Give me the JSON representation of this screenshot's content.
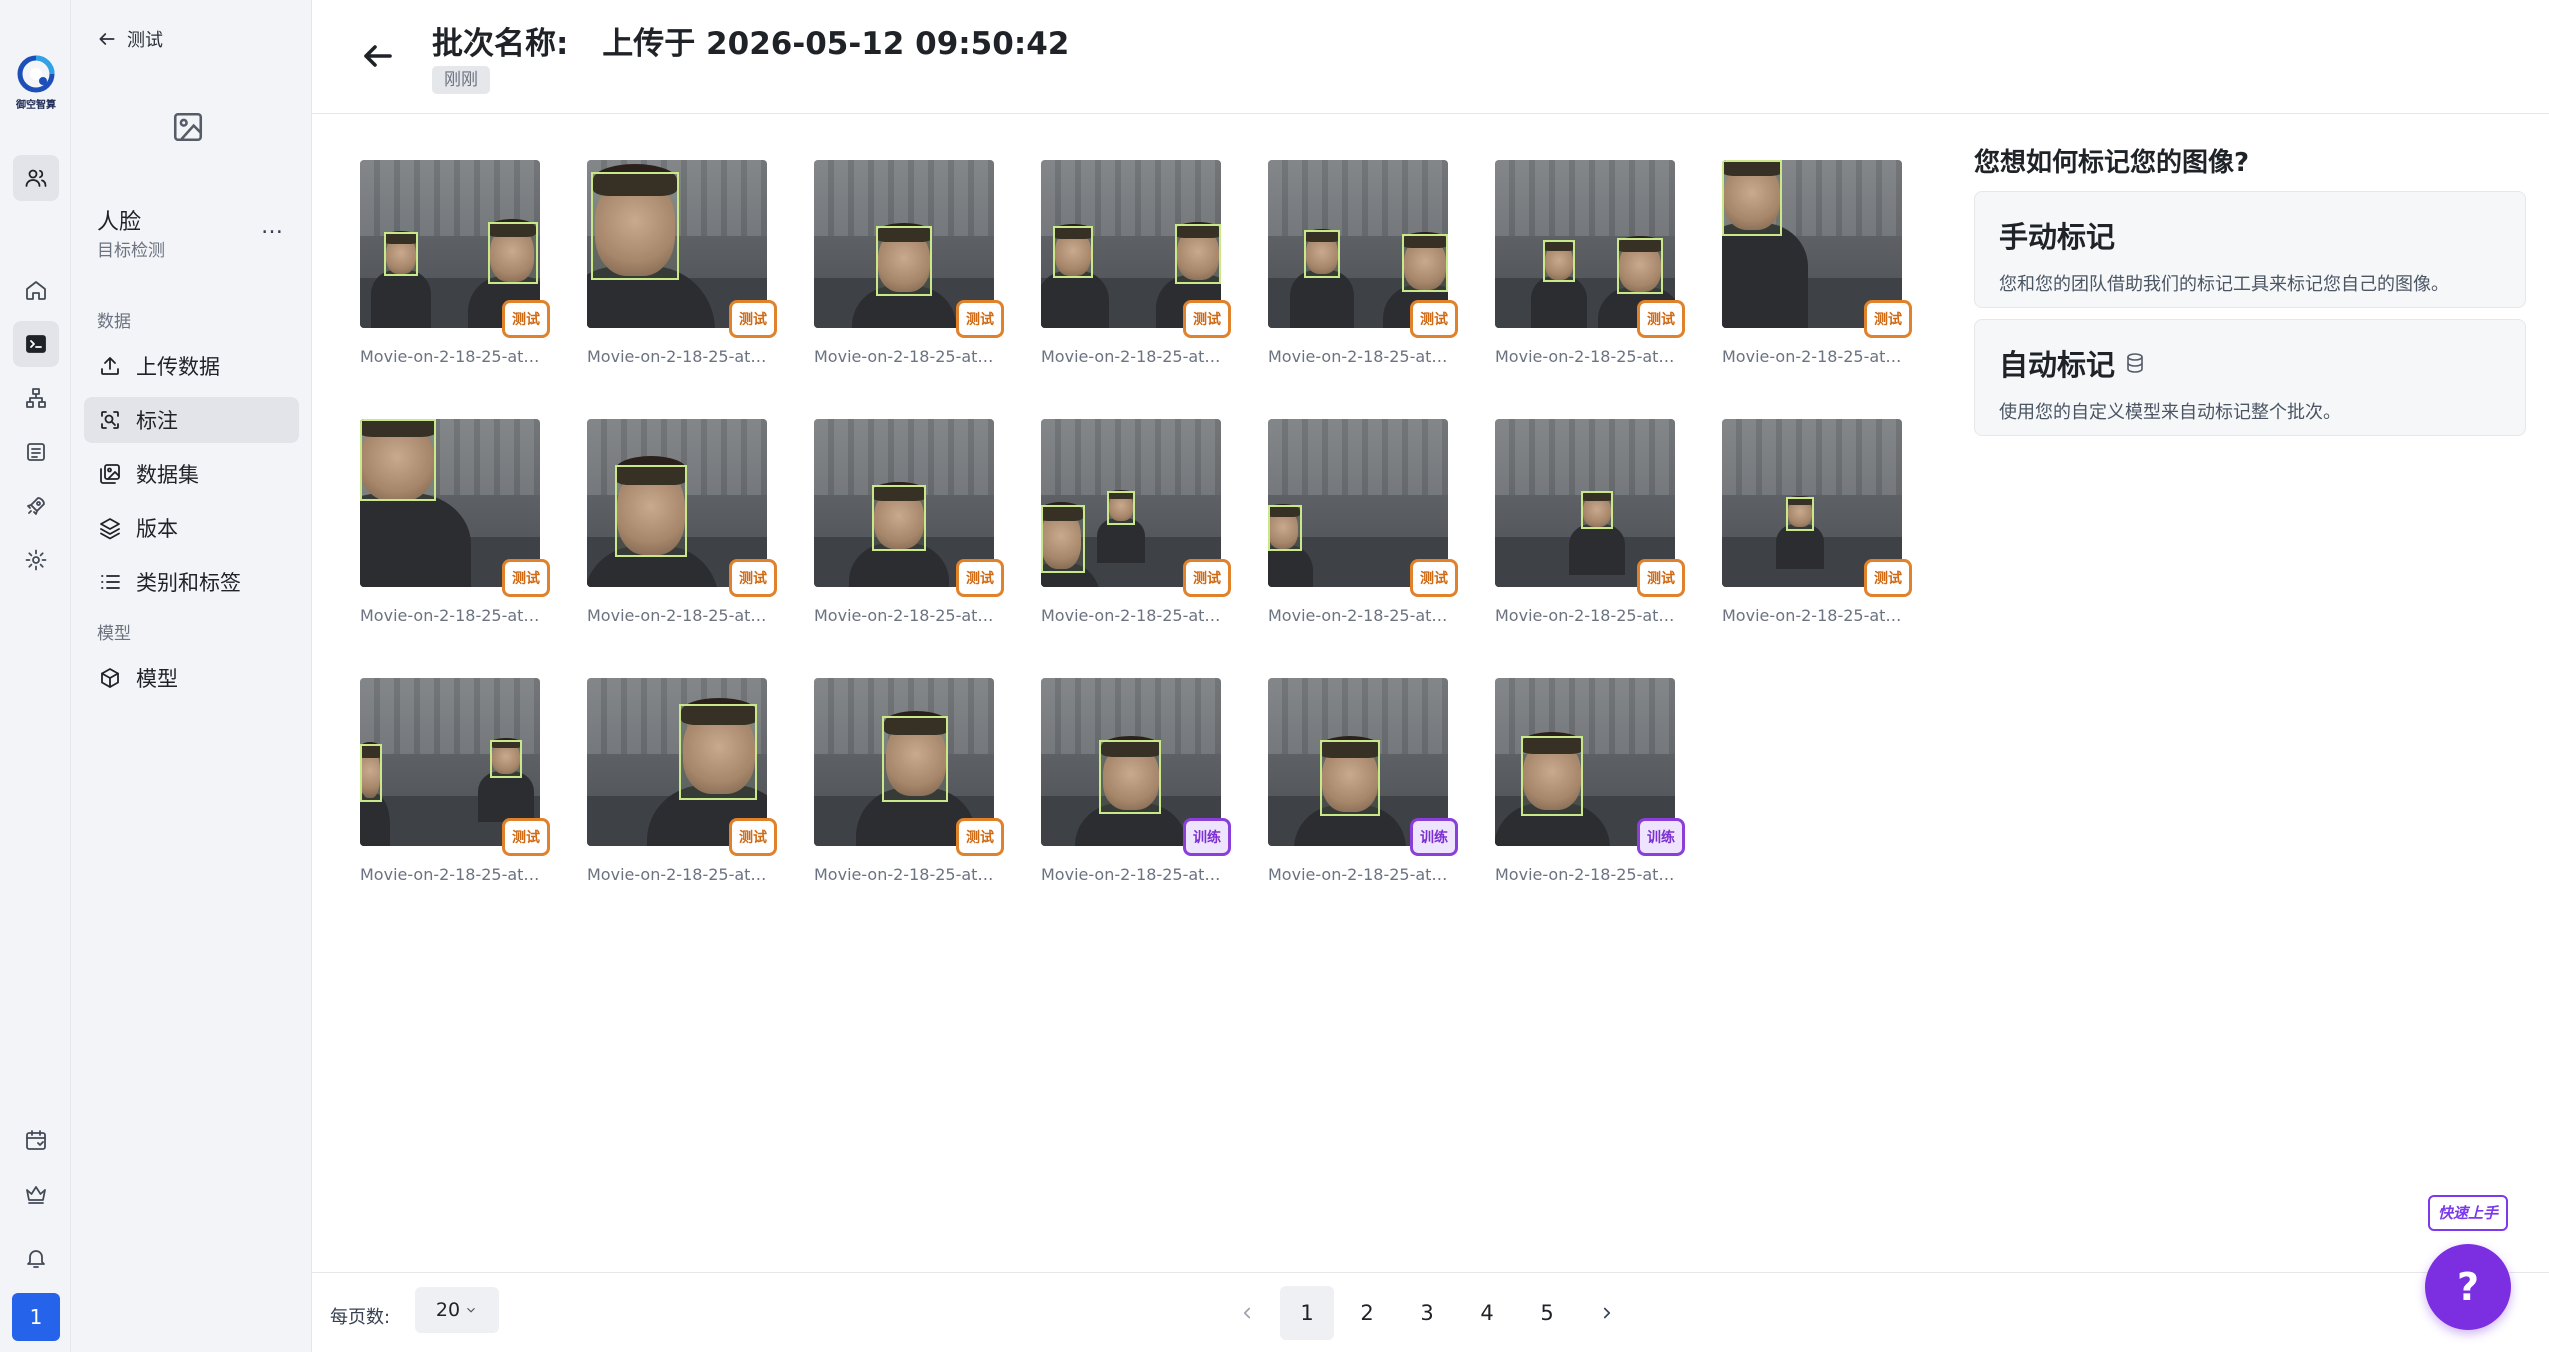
{
  "brand": {
    "logo_text": "御空智算"
  },
  "rail": {
    "badge": "1"
  },
  "sidebar": {
    "back_label": "测试",
    "project_name": "人脸",
    "project_type": "目标检测",
    "more": "…",
    "section_data": "数据",
    "section_model": "模型",
    "items": [
      {
        "label": "上传数据",
        "icon": "upload-icon"
      },
      {
        "label": "标注",
        "icon": "annotate-icon"
      },
      {
        "label": "数据集",
        "icon": "dataset-icon"
      },
      {
        "label": "版本",
        "icon": "layers-icon"
      },
      {
        "label": "类别和标签",
        "icon": "list-icon"
      },
      {
        "label": "模型",
        "icon": "cube-icon"
      }
    ]
  },
  "header": {
    "title_label": "批次名称:",
    "title_value": "上传于 2026-05-12 09:50:42",
    "tag": "刚刚"
  },
  "images": [
    {
      "name": "Movie-on-2-18-25-at-…",
      "split": "测试"
    },
    {
      "name": "Movie-on-2-18-25-at-…",
      "split": "测试"
    },
    {
      "name": "Movie-on-2-18-25-at-…",
      "split": "测试"
    },
    {
      "name": "Movie-on-2-18-25-at-…",
      "split": "测试"
    },
    {
      "name": "Movie-on-2-18-25-at-…",
      "split": "测试"
    },
    {
      "name": "Movie-on-2-18-25-at-…",
      "split": "测试"
    },
    {
      "name": "Movie-on-2-18-25-at-…",
      "split": "测试"
    },
    {
      "name": "Movie-on-2-18-25-at-…",
      "split": "测试"
    },
    {
      "name": "Movie-on-2-18-25-at-…",
      "split": "测试"
    },
    {
      "name": "Movie-on-2-18-25-at-…",
      "split": "测试"
    },
    {
      "name": "Movie-on-2-18-25-at-…",
      "split": "测试"
    },
    {
      "name": "Movie-on-2-18-25-at-…",
      "split": "测试"
    },
    {
      "name": "Movie-on-2-18-25-at-…",
      "split": "测试"
    },
    {
      "name": "Movie-on-2-18-25-at-…",
      "split": "测试"
    },
    {
      "name": "Movie-on-2-18-25-at-…",
      "split": "测试"
    },
    {
      "name": "Movie-on-2-18-25-at-…",
      "split": "测试"
    },
    {
      "name": "Movie-on-2-18-25-at-…",
      "split": "测试"
    },
    {
      "name": "Movie-on-2-18-25-at-…",
      "split": "训练"
    },
    {
      "name": "Movie-on-2-18-25-at-…",
      "split": "训练"
    },
    {
      "name": "Movie-on-2-18-25-at-…",
      "split": "训练"
    }
  ],
  "right_panel": {
    "title": "您想如何标记您的图像?",
    "manual": {
      "title": "手动标记",
      "desc": "您和您的团队借助我们的标记工具来标记您自己的图像。"
    },
    "auto": {
      "title": "自动标记",
      "desc": "使用您的自定义模型来自动标记整个批次。"
    }
  },
  "footer": {
    "per_page_label": "每页数:",
    "per_page_value": "20",
    "pages": [
      "1",
      "2",
      "3",
      "4",
      "5"
    ],
    "current_page": "1"
  },
  "help": {
    "quick_label": "快速上手",
    "button": "?"
  },
  "colors": {
    "accent": "#2563eb",
    "test_tag": "#e0812b",
    "train_tag": "#8b3fd9",
    "bbox": "#c8e88a",
    "help": "#7b2fe0"
  }
}
